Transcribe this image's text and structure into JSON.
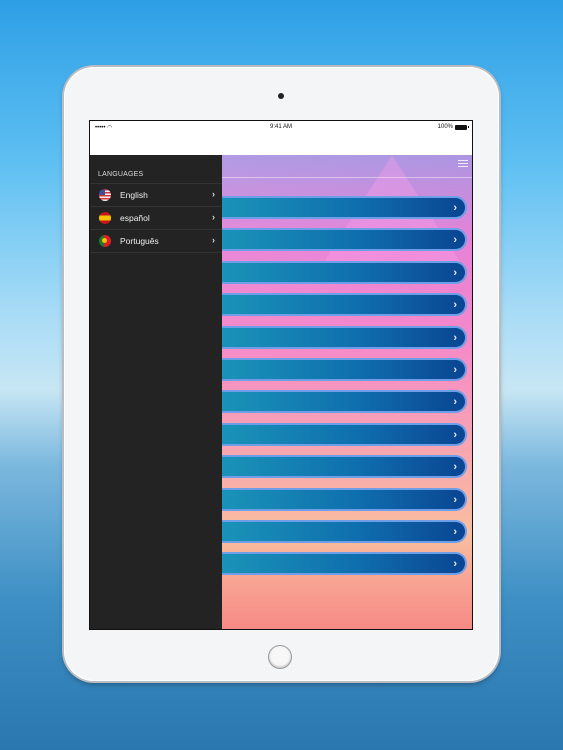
{
  "status_bar": {
    "signal": "••••• ◠",
    "time": "9:41 AM",
    "battery": "100%"
  },
  "sidebar": {
    "header": "LANGUAGES",
    "items": [
      {
        "label": "English",
        "flag": "us-flag-icon"
      },
      {
        "label": "español",
        "flag": "spain-flag-icon"
      },
      {
        "label": "Português",
        "flag": "portugal-flag-icon"
      }
    ],
    "chevron": "›"
  },
  "content": {
    "menu_icon": "hamburger-menu-icon",
    "buttons": [
      {
        "label": "",
        "chevron": "›"
      },
      {
        "label": "",
        "chevron": "›"
      },
      {
        "label": "",
        "chevron": "›"
      },
      {
        "label": "",
        "chevron": "›"
      },
      {
        "label": "",
        "chevron": "›"
      },
      {
        "label": "",
        "chevron": "›"
      },
      {
        "label": "",
        "chevron": "›"
      },
      {
        "label": "",
        "chevron": "›"
      },
      {
        "label": "",
        "chevron": "›"
      },
      {
        "label": "",
        "chevron": "›"
      },
      {
        "label": "",
        "chevron": "›"
      },
      {
        "label": "",
        "chevron": "›"
      }
    ]
  },
  "colors": {
    "sidebar_bg": "#232323",
    "button_start": "#1a93b8",
    "button_end": "#0a4592",
    "button_border": "#6f9ee8"
  }
}
